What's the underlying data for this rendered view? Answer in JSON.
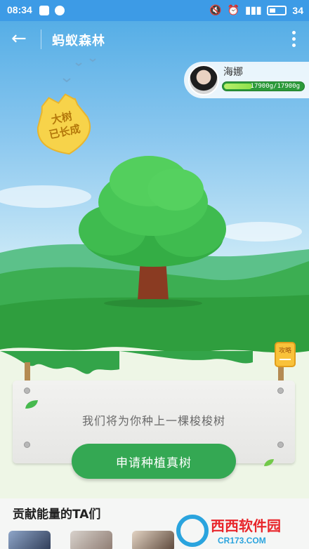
{
  "status": {
    "time": "08:34",
    "battery": "34"
  },
  "appbar": {
    "title": "蚂蚁森林",
    "back_icon": "arrow-left-icon",
    "more_icon": "more-vert-icon"
  },
  "user": {
    "name": "海娜",
    "energy_text": "17900g/17900g"
  },
  "badge": {
    "line1": "大树",
    "line2": "已长成"
  },
  "panel": {
    "message": "我们将为你种上一棵梭梭树"
  },
  "apply_button": "申请种植真树",
  "strategy_label": "攻略",
  "contributors": {
    "title": "贡献能量的TA们"
  },
  "watermark": {
    "brand": "西西软件园",
    "url": "CR173.COM"
  },
  "colors": {
    "primary_green": "#34a853",
    "sky_blue": "#56aee6",
    "status_blue": "#3d9be6"
  }
}
